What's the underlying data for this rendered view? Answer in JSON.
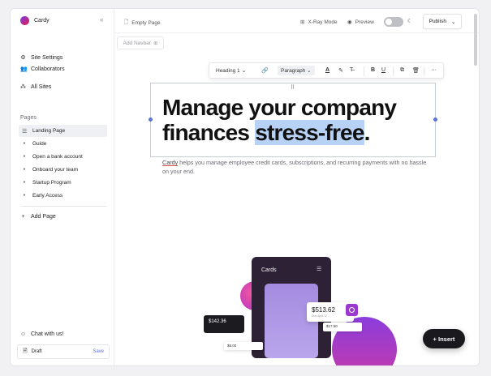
{
  "sidebar": {
    "brand": "Cardy",
    "collapse_icon": "collapse-icon",
    "nav": [
      {
        "label": "Site Settings",
        "icon": "settings-icon"
      },
      {
        "label": "Collaborators",
        "icon": "users-icon"
      },
      {
        "label": "All Sites",
        "icon": "sites-icon"
      }
    ],
    "pages_label": "Pages",
    "pages": [
      {
        "label": "Landing Page"
      },
      {
        "label": "Guide"
      },
      {
        "label": "Open a bank account"
      },
      {
        "label": "Onboard your team"
      },
      {
        "label": "Startup Program"
      },
      {
        "label": "Early Access"
      }
    ],
    "add_page": "Add Page",
    "chat": "Chat with us!",
    "draft_label": "Draft",
    "save_label": "Save"
  },
  "topbar": {
    "page_label": "Empty Page",
    "xray": "X-Ray Mode",
    "preview": "Preview",
    "publish": "Publish"
  },
  "add_navbar": "Add Navbar",
  "toolbar": {
    "heading": "Heading 1",
    "paragraph": "Paragraph",
    "bold": "B",
    "underline": "U",
    "more": "···"
  },
  "content": {
    "heading_part1": "Manage your company finances ",
    "heading_highlight": "stress-free",
    "heading_end": ".",
    "sub_brand": "Cardy",
    "sub_rest": " helps you manage employee credit cards, subscriptions, and recurring payments with no hassle on your end."
  },
  "illustration": {
    "phone_title": "Cards",
    "amount_dark": "$142.36",
    "amount_white": "$513.62",
    "amount_white_sub": "Due April 12",
    "amount_small": "$17.50",
    "amount_tiny": "$8.00"
  },
  "insert": "+ Insert"
}
